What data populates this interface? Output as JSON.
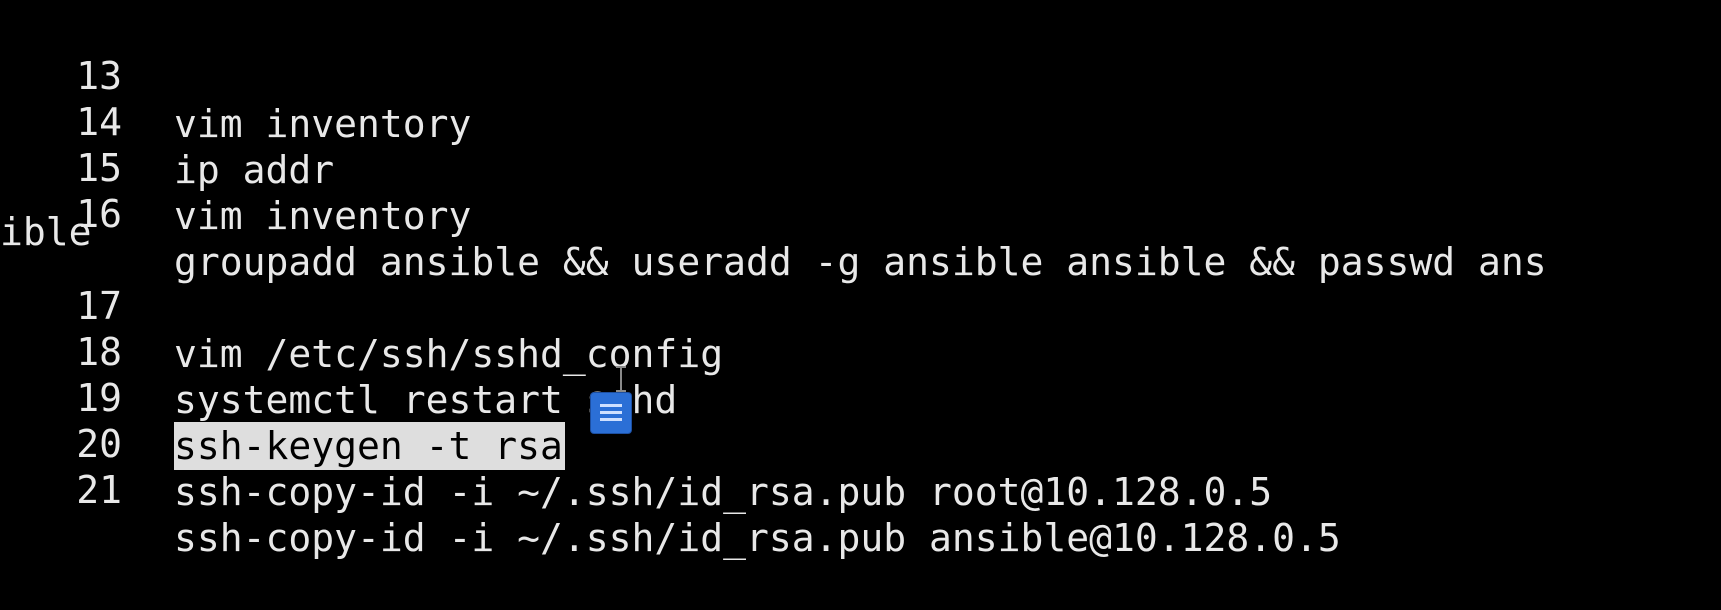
{
  "terminal": {
    "lines": [
      {
        "num": "13",
        "cmd": "vim inventory"
      },
      {
        "num": "14",
        "cmd": "ip addr"
      },
      {
        "num": "15",
        "cmd": "vim inventory"
      },
      {
        "num": "16",
        "cmd": "groupadd ansible && useradd -g ansible ansible && passwd ans"
      },
      {
        "num": "17",
        "cmd": "vim /etc/ssh/sshd_config"
      },
      {
        "num": "18",
        "cmd": "systemctl restart sshd"
      },
      {
        "num": "19",
        "cmd": "ssh-keygen -t rsa"
      },
      {
        "num": "20",
        "cmd": "ssh-copy-id -i ~/.ssh/id_rsa.pub root@10.128.0.5"
      },
      {
        "num": "21",
        "cmd": "ssh-copy-id -i ~/.ssh/id_rsa.pub ansible@10.128.0.5"
      }
    ],
    "line16_wrap": "ible",
    "selected_line": "19"
  },
  "icons": {
    "cursor": "text-ibeam-cursor-icon",
    "drag": "document-drag-icon"
  },
  "colors": {
    "background": "#000000",
    "text": "#e8e8e8",
    "selection": "#dedede",
    "drag_icon": "#2b6fd6"
  }
}
